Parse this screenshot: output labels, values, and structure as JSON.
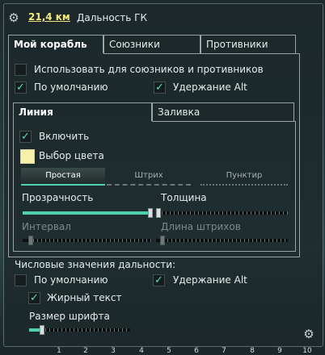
{
  "header": {
    "distance_value": "21,4 км",
    "distance_label": "Дальность ГК"
  },
  "tabs": [
    {
      "label": "Мой корабль",
      "active": true
    },
    {
      "label": "Союзники",
      "active": false
    },
    {
      "label": "Противники",
      "active": false
    }
  ],
  "options": {
    "use_for_allies": {
      "label": "Использовать для союзников и противников",
      "checked": false
    },
    "default": {
      "label": "По умолчанию",
      "checked": true
    },
    "hold_alt": {
      "label": "Удержание Alt",
      "checked": true
    }
  },
  "subtabs": [
    {
      "label": "Линия",
      "active": true
    },
    {
      "label": "Заливка",
      "active": false
    }
  ],
  "line": {
    "enable": {
      "label": "Включить",
      "checked": true
    },
    "color_label": "Выбор цвета",
    "color": "#f7f0a8",
    "styles": [
      {
        "label": "Простая",
        "selected": true
      },
      {
        "label": "Штрих",
        "selected": false
      },
      {
        "label": "Пунктир",
        "selected": false
      }
    ],
    "sliders": {
      "opacity": {
        "label": "Прозрачность",
        "value": 1.0
      },
      "thickness": {
        "label": "Толщина",
        "value": 0.0
      },
      "interval": {
        "label": "Интервал",
        "value": 0.05
      },
      "dash_length": {
        "label": "Длина штрихов",
        "value": 0.03
      }
    }
  },
  "numeric": {
    "title": "Числовые значения дальности:",
    "default": {
      "label": "По умолчанию",
      "checked": false
    },
    "hold_alt": {
      "label": "Удержание Alt",
      "checked": true
    },
    "bold": {
      "label": "Жирный текст",
      "checked": true
    },
    "font_size": {
      "label": "Размер шрифта",
      "value": 0.13
    }
  },
  "axis_numbers": [
    "1",
    "2",
    "3",
    "4",
    "5",
    "6",
    "7",
    "8",
    "9",
    "10"
  ],
  "colors": {
    "accent": "#4fd1b0",
    "link": "#f1e879"
  }
}
